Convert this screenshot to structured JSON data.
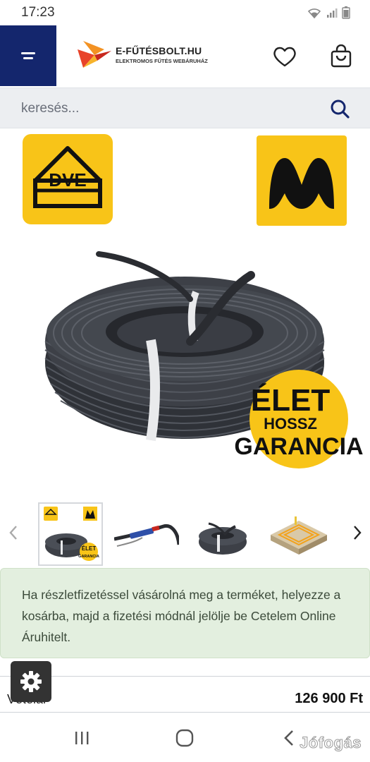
{
  "status_bar": {
    "time": "17:23",
    "icons": [
      "wifi-icon",
      "signal-icon",
      "battery-icon"
    ]
  },
  "header": {
    "menu_icon": "hamburger-menu-icon",
    "logo_name": "E-FŰTÉSBOLT.HU",
    "logo_subtitle": "ELEKTROMOS FŰTÉS WEBÁRUHÁZ",
    "wishlist_icon": "heart-icon",
    "cart_icon": "shopping-bag-icon"
  },
  "search": {
    "placeholder": "keresés...",
    "icon": "search-icon"
  },
  "product_image": {
    "badge_line1": "ÉLET",
    "badge_line2": "HOSSZ",
    "badge_line3": "GARANCIA",
    "vde_letters": "DVE",
    "brand_logo": "M"
  },
  "thumbnails": {
    "prev_icon": "chevron-left-icon",
    "next_icon": "chevron-right-icon",
    "items": [
      {
        "name": "thumb-cable-coil-badges",
        "active": true
      },
      {
        "name": "thumb-cable-connector"
      },
      {
        "name": "thumb-cable-coil"
      },
      {
        "name": "thumb-floor-installation"
      }
    ]
  },
  "notice": {
    "text": "Ha részletfizetéssel vásárolná meg a terméket, helyezze a kosárba, majd a fizetési módnál jelölje be Cetelem Online Áruhitelt."
  },
  "price_row": {
    "label": "Vételár",
    "value": "126 900 Ft"
  },
  "settings_icon": "gear-icon",
  "nav_bar": {
    "recent_icon": "recent-apps-icon",
    "home_icon": "home-icon",
    "back_icon": "back-icon"
  },
  "watermark": "Jófogás",
  "colors": {
    "header_menu_bg": "#14266d",
    "accent_blue": "#14266d",
    "notice_bg": "#e3efdf",
    "badge_yellow": "#f8c418"
  }
}
